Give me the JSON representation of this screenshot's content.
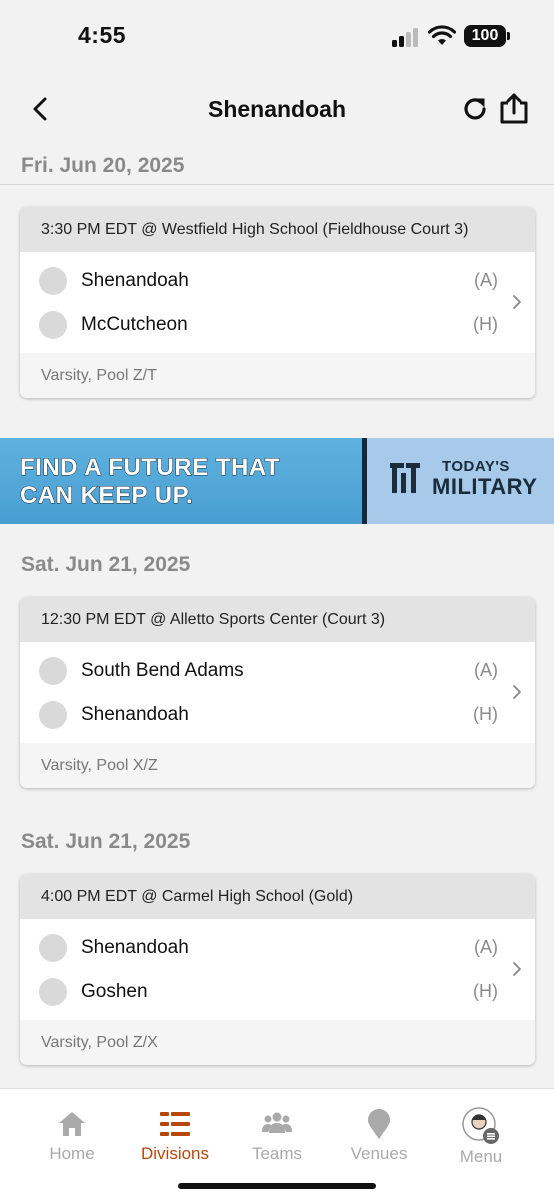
{
  "status_bar": {
    "time": "4:55",
    "battery": "100"
  },
  "nav": {
    "title": "Shenandoah"
  },
  "dates": [
    "Fri. Jun 20, 2025",
    "Sat. Jun 21, 2025",
    "Sat. Jun 21, 2025"
  ],
  "games": [
    {
      "header": "3:30 PM EDT @ Westfield High School (Fieldhouse Court 3)",
      "team1": "Shenandoah",
      "role1": "(A)",
      "team2": "McCutcheon",
      "role2": "(H)",
      "footer": "Varsity, Pool Z/T"
    },
    {
      "header": "12:30 PM EDT @ Alletto Sports Center (Court 3)",
      "team1": "South Bend Adams",
      "role1": "(A)",
      "team2": "Shenandoah",
      "role2": "(H)",
      "footer": "Varsity, Pool X/Z"
    },
    {
      "header": "4:00 PM EDT @ Carmel High School (Gold)",
      "team1": "Shenandoah",
      "role1": "(A)",
      "team2": "Goshen",
      "role2": "(H)",
      "footer": "Varsity, Pool Z/X"
    }
  ],
  "ad": {
    "line1": "FIND A FUTURE THAT",
    "line2": "CAN KEEP UP.",
    "brand_line1": "TODAY'S",
    "brand_line2": "MILITARY"
  },
  "tabs": [
    {
      "label": "Home",
      "icon": "home-icon",
      "active": false
    },
    {
      "label": "Divisions",
      "icon": "divisions-icon",
      "active": true
    },
    {
      "label": "Teams",
      "icon": "teams-icon",
      "active": false
    },
    {
      "label": "Venues",
      "icon": "venues-icon",
      "active": false
    },
    {
      "label": "Menu",
      "icon": "menu-icon",
      "active": false
    }
  ],
  "colors": {
    "accent": "#b8470f",
    "inactive_tab": "#aaaaaa",
    "background": "#f2f2f2"
  }
}
